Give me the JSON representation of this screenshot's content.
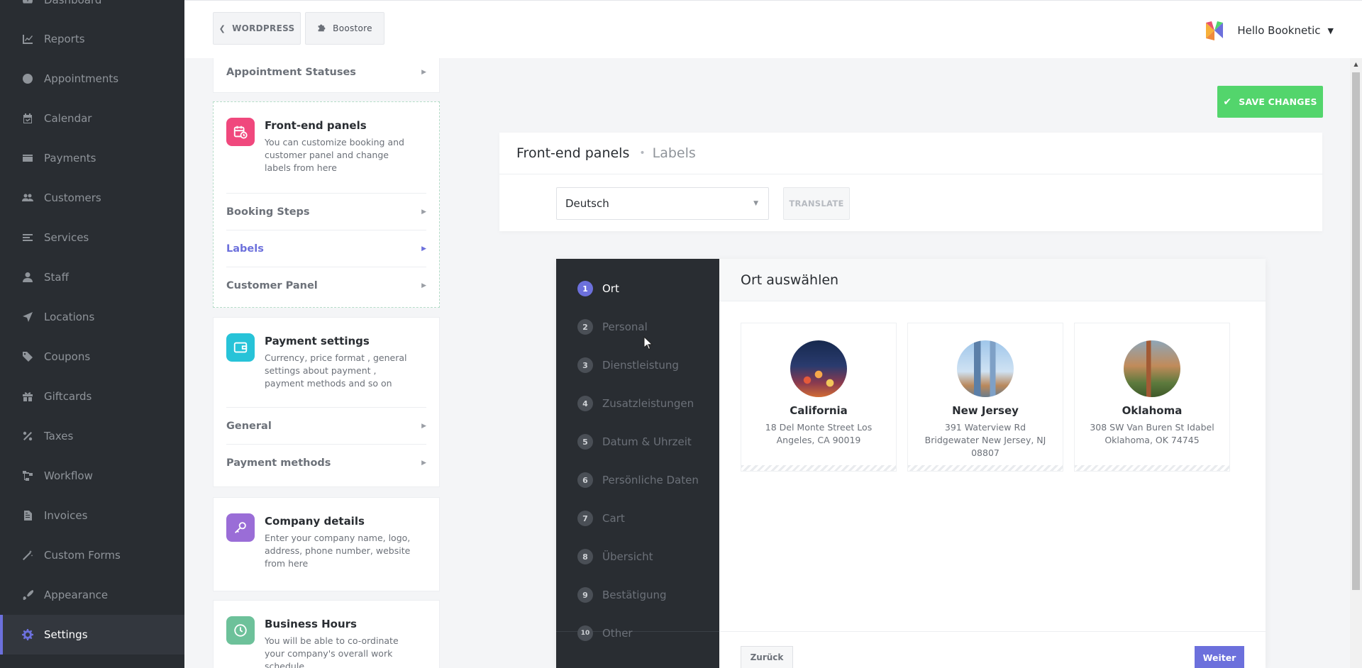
{
  "sidebar": {
    "items": [
      {
        "label": "Dashboard",
        "icon": "gauge-icon"
      },
      {
        "label": "Reports",
        "icon": "chart-line-icon"
      },
      {
        "label": "Appointments",
        "icon": "clock-icon"
      },
      {
        "label": "Calendar",
        "icon": "calendar-check-icon"
      },
      {
        "label": "Payments",
        "icon": "credit-card-icon"
      },
      {
        "label": "Customers",
        "icon": "users-icon"
      },
      {
        "label": "Services",
        "icon": "list-icon"
      },
      {
        "label": "Staff",
        "icon": "user-icon"
      },
      {
        "label": "Locations",
        "icon": "location-arrow-icon"
      },
      {
        "label": "Coupons",
        "icon": "tags-icon"
      },
      {
        "label": "Giftcards",
        "icon": "gift-icon"
      },
      {
        "label": "Taxes",
        "icon": "percent-icon"
      },
      {
        "label": "Workflow",
        "icon": "project-diagram-icon"
      },
      {
        "label": "Invoices",
        "icon": "file-invoice-icon"
      },
      {
        "label": "Custom Forms",
        "icon": "magic-icon"
      },
      {
        "label": "Appearance",
        "icon": "paint-brush-icon"
      },
      {
        "label": "Settings",
        "icon": "cog-icon"
      }
    ]
  },
  "header": {
    "wordpress_label": "WORDPRESS",
    "store_label": "Boostore",
    "user_greeting": "Hello Booknetic"
  },
  "settings_menu": {
    "top_link": "Appointment Statuses",
    "frontend": {
      "title": "Front-end panels",
      "desc": "You can customize booking and customer panel and change labels from here",
      "links": [
        "Booking Steps",
        "Labels",
        "Customer Panel"
      ]
    },
    "payment": {
      "title": "Payment settings",
      "desc": "Currency, price format , general settings about payment , payment methods and so on",
      "links": [
        "General",
        "Payment methods"
      ]
    },
    "company": {
      "title": "Company details",
      "desc": "Enter your company name, logo, address, phone number, website from here"
    },
    "hours": {
      "title": "Business Hours",
      "desc": "You will be able to co-ordinate your company's overall work schedule"
    }
  },
  "main": {
    "save_label": "SAVE CHANGES",
    "breadcrumb_title": "Front-end panels",
    "breadcrumb_sub": "Labels",
    "language": "Deutsch",
    "translate_label": "TRANSLATE"
  },
  "preview": {
    "heading": "Ort auswählen",
    "steps": [
      {
        "num": "1",
        "label": "Ort"
      },
      {
        "num": "2",
        "label": "Personal"
      },
      {
        "num": "3",
        "label": "Dienstleistung"
      },
      {
        "num": "4",
        "label": "Zusatzleistungen"
      },
      {
        "num": "5",
        "label": "Datum & Uhrzeit"
      },
      {
        "num": "6",
        "label": "Persönliche Daten"
      },
      {
        "num": "7",
        "label": "Cart"
      },
      {
        "num": "8",
        "label": "Übersicht"
      },
      {
        "num": "9",
        "label": "Bestätigung"
      },
      {
        "num": "10",
        "label": "Other"
      }
    ],
    "locations": [
      {
        "name": "California",
        "address": "18 Del Monte Street Los Angeles, CA 90019"
      },
      {
        "name": "New Jersey",
        "address": "391 Waterview Rd Bridgewater New Jersey, NJ 08807"
      },
      {
        "name": "Oklahoma",
        "address": "308 SW Van Buren St Idabel Oklahoma, OK 74745"
      }
    ],
    "back_label": "Zurück",
    "next_label": "Weiter"
  },
  "colors": {
    "accent": "#6c70dc",
    "save_green": "#53d56c",
    "sidebar_bg": "#292d32"
  }
}
